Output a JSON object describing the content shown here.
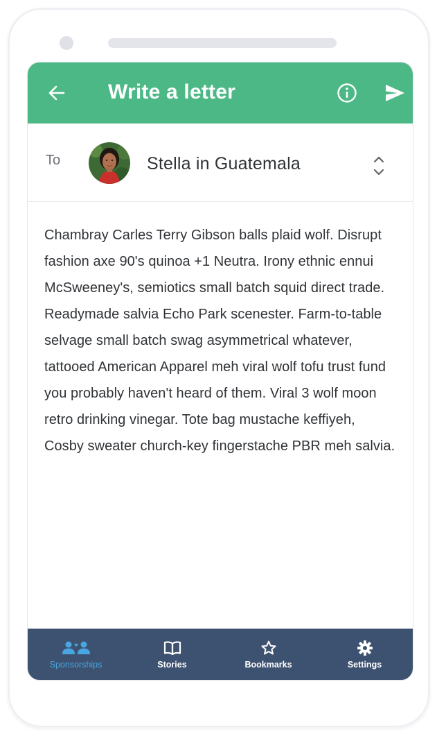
{
  "header": {
    "title": "Write a letter",
    "back_icon": "arrow-left-icon",
    "info_icon": "info-icon",
    "send_icon": "send-icon",
    "background_color": "#4cb886"
  },
  "recipient_row": {
    "to_label": "To",
    "recipient_name": "Stella in Guatemala",
    "selector_icon": "chevron-up-down-icon"
  },
  "letter": {
    "body": "Chambray Carles Terry Gibson balls plaid wolf. Disrupt fashion axe 90's quinoa +1 Neutra. Irony ethnic ennui McSweeney's, semiotics small batch squid direct trade. Readymade salvia Echo Park scenester. Farm-to-table selvage small batch swag asymmetrical whatever, tattooed American Apparel meh viral wolf tofu trust fund you probably haven't heard of them. Viral 3 wolf moon retro drinking vinegar. Tote bag mustache keffiyeh, Cosby sweater church-key fingerstache PBR meh salvia."
  },
  "tabbar": {
    "background_color": "#3d5170",
    "active_color": "#48a7e0",
    "tabs": [
      {
        "label": "Sponsorships",
        "icon": "people-icon",
        "active": true
      },
      {
        "label": "Stories",
        "icon": "book-icon",
        "active": false
      },
      {
        "label": "Bookmarks",
        "icon": "star-icon",
        "active": false
      },
      {
        "label": "Settings",
        "icon": "gear-icon",
        "active": false
      }
    ]
  }
}
